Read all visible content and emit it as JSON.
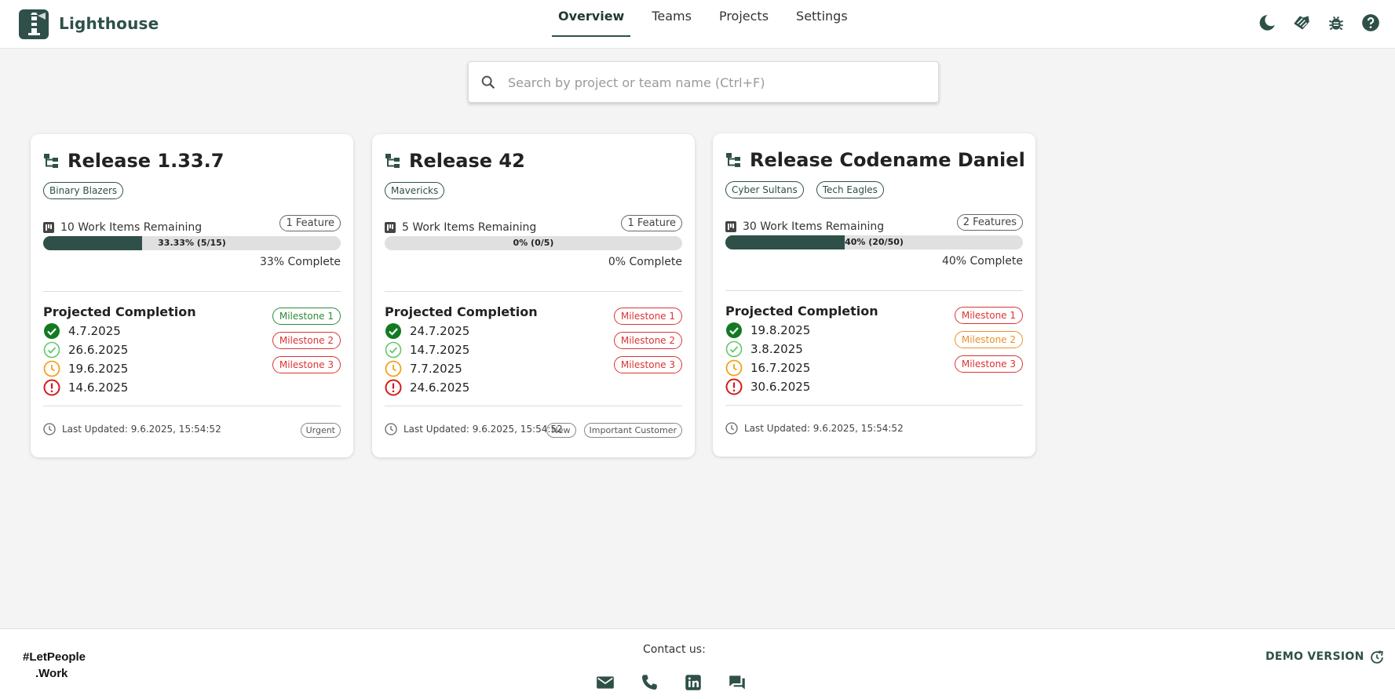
{
  "app": {
    "title": "Lighthouse",
    "accent": "#2e5048"
  },
  "nav": {
    "items": [
      {
        "label": "Overview",
        "active": true
      },
      {
        "label": "Teams",
        "active": false
      },
      {
        "label": "Projects",
        "active": false
      },
      {
        "label": "Settings",
        "active": false
      }
    ]
  },
  "top_icons": [
    "moon-icon",
    "hands-icon",
    "bug-icon",
    "help-icon"
  ],
  "search": {
    "placeholder": "Search by project or team name (Ctrl+F)",
    "value": ""
  },
  "releases": [
    {
      "title": "Release 1.33.7",
      "teams": [
        "Binary Blazers"
      ],
      "work_items_text": "10 Work Items Remaining",
      "features_text": "1 Feature",
      "progress_text": "33.33% (5/15)",
      "progress_fraction": 0.3333,
      "complete_text": "33% Complete",
      "projected_title": "Projected Completion",
      "forecasts": [
        {
          "date": "4.7.2025",
          "icon": "check-filled-icon"
        },
        {
          "date": "26.6.2025",
          "icon": "check-outline-icon"
        },
        {
          "date": "19.6.2025",
          "icon": "clock-icon"
        },
        {
          "date": "14.6.2025",
          "icon": "alert-icon"
        }
      ],
      "milestones": [
        {
          "label": "Milestone 1",
          "status": "green"
        },
        {
          "label": "Milestone 2",
          "status": "red"
        },
        {
          "label": "Milestone 3",
          "status": "red"
        }
      ],
      "last_updated": "Last Updated: 9.6.2025, 15:54:52",
      "tags": [
        "Urgent"
      ]
    },
    {
      "title": "Release 42",
      "teams": [
        "Mavericks"
      ],
      "work_items_text": "5 Work Items Remaining",
      "features_text": "1 Feature",
      "progress_text": "0% (0/5)",
      "progress_fraction": 0,
      "complete_text": "0% Complete",
      "projected_title": "Projected Completion",
      "forecasts": [
        {
          "date": "24.7.2025",
          "icon": "check-filled-icon"
        },
        {
          "date": "14.7.2025",
          "icon": "check-outline-icon"
        },
        {
          "date": "7.7.2025",
          "icon": "clock-icon"
        },
        {
          "date": "24.6.2025",
          "icon": "alert-icon"
        }
      ],
      "milestones": [
        {
          "label": "Milestone 1",
          "status": "red"
        },
        {
          "label": "Milestone 2",
          "status": "red"
        },
        {
          "label": "Milestone 3",
          "status": "red"
        }
      ],
      "last_updated": "Last Updated: 9.6.2025, 15:54:52",
      "tags": [
        "New",
        "Important Customer"
      ]
    },
    {
      "title": "Release Codename Daniel",
      "teams": [
        "Cyber Sultans",
        "Tech Eagles"
      ],
      "work_items_text": "30 Work Items Remaining",
      "features_text": "2 Features",
      "progress_text": "40% (20/50)",
      "progress_fraction": 0.4,
      "complete_text": "40% Complete",
      "projected_title": "Projected Completion",
      "forecasts": [
        {
          "date": "19.8.2025",
          "icon": "check-filled-icon"
        },
        {
          "date": "3.8.2025",
          "icon": "check-outline-icon"
        },
        {
          "date": "16.7.2025",
          "icon": "clock-icon"
        },
        {
          "date": "30.6.2025",
          "icon": "alert-icon"
        }
      ],
      "milestones": [
        {
          "label": "Milestone 1",
          "status": "red"
        },
        {
          "label": "Milestone 2",
          "status": "orange"
        },
        {
          "label": "Milestone 3",
          "status": "red"
        }
      ],
      "last_updated": "Last Updated: 9.6.2025, 15:54:52",
      "tags": []
    }
  ],
  "footer": {
    "brand_line1": "#LetPeople",
    "brand_line2": ".Work",
    "contact_label": "Contact us:",
    "contact_icons": [
      "mail-icon",
      "phone-icon",
      "linkedin-icon",
      "chat-icon"
    ],
    "demo_label": "DEMO VERSION"
  }
}
